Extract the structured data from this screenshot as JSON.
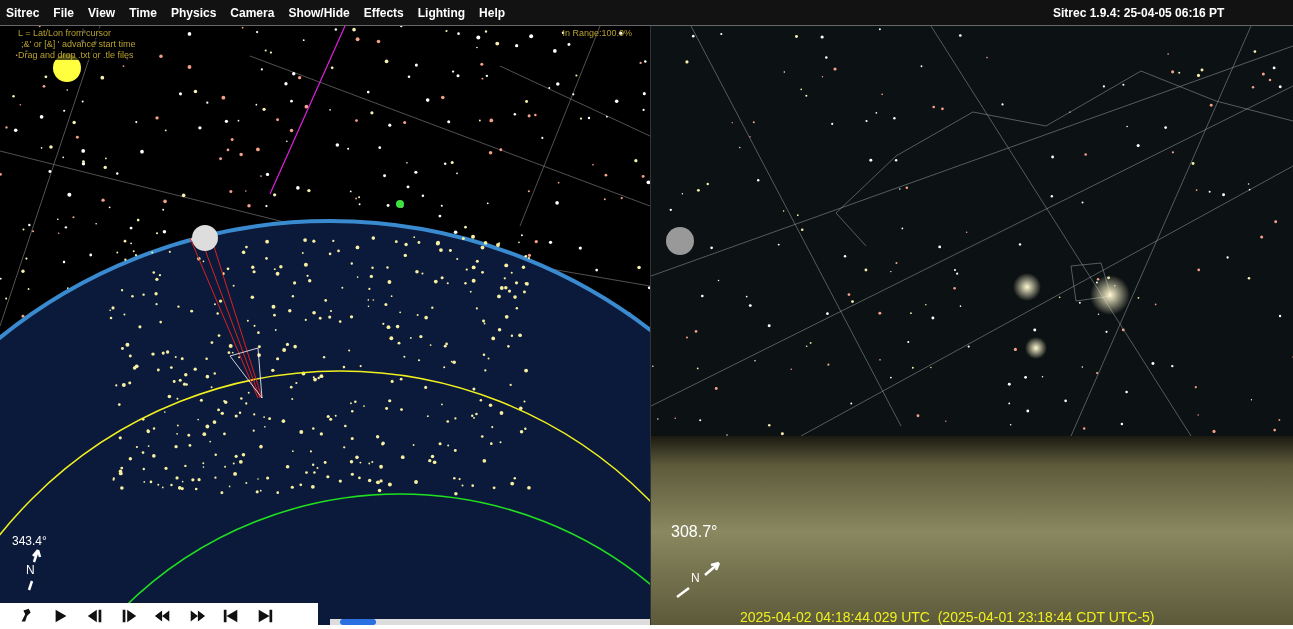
{
  "menu_bar": {
    "items": [
      "Sitrec",
      "File",
      "View",
      "Time",
      "Physics",
      "Camera",
      "Show/Hide",
      "Effects",
      "Lighting",
      "Help"
    ],
    "version": "Sitrec 1.9.4: 25-04-05 06:16 PT"
  },
  "left_view": {
    "help_lines": [
      "L = Lat/Lon from cursor",
      ";&' or [&] ' advance start time",
      "Drag and drop .txt or .tle files"
    ],
    "in_range": "In Range:100.0%",
    "heading": "343.4°",
    "compass_label": "N"
  },
  "right_view": {
    "heading": "308.7°",
    "compass_label": "N",
    "time_readout": "2025-04-02 04:18:44.029 UTC  (2025-04-01 23:18:44 CDT UTC-5)"
  },
  "playback": {
    "buttons": [
      {
        "kind": "pin"
      },
      {
        "kind": "play"
      },
      {
        "kind": "step-back"
      },
      {
        "kind": "step-forward"
      },
      {
        "kind": "rewind"
      },
      {
        "kind": "fast-forward"
      },
      {
        "kind": "start"
      },
      {
        "kind": "end"
      }
    ],
    "time_slider": {
      "level": 0.03
    }
  }
}
